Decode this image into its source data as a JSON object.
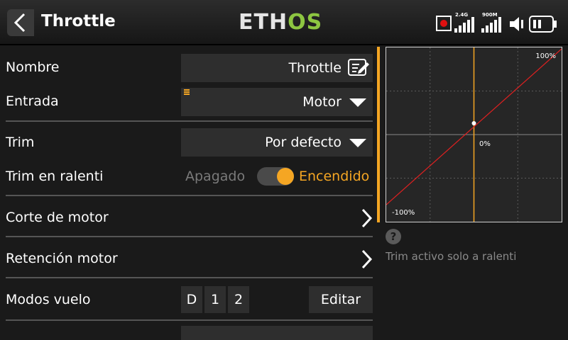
{
  "header": {
    "title": "Throttle",
    "logo_prefix": "ETH",
    "logo_suffix": "OS",
    "signal_24g": "2.4G",
    "signal_900m": "900M"
  },
  "settings": {
    "name_label": "Nombre",
    "name_value": "Throttle",
    "input_label": "Entrada",
    "input_value": "Motor",
    "trim_label": "Trim",
    "trim_value": "Por defecto",
    "idle_trim_label": "Trim en ralenti",
    "idle_trim_off": "Apagado",
    "idle_trim_on": "Encendido",
    "motor_cut_label": "Corte de motor",
    "motor_hold_label": "Retención motor",
    "flight_modes_label": "Modos vuelo",
    "flight_modes": [
      "D",
      "1",
      "2"
    ],
    "edit_label": "Editar"
  },
  "graph": {
    "top_right_label": "100%",
    "center_label": "0%",
    "bottom_left_label": "-100%"
  },
  "help": {
    "icon": "question-icon",
    "text": "Trim activo solo a ralenti"
  },
  "colors": {
    "accent": "#f5a623",
    "logo_green": "#8dc641",
    "curve": "#e02020",
    "record": "#e01010"
  }
}
